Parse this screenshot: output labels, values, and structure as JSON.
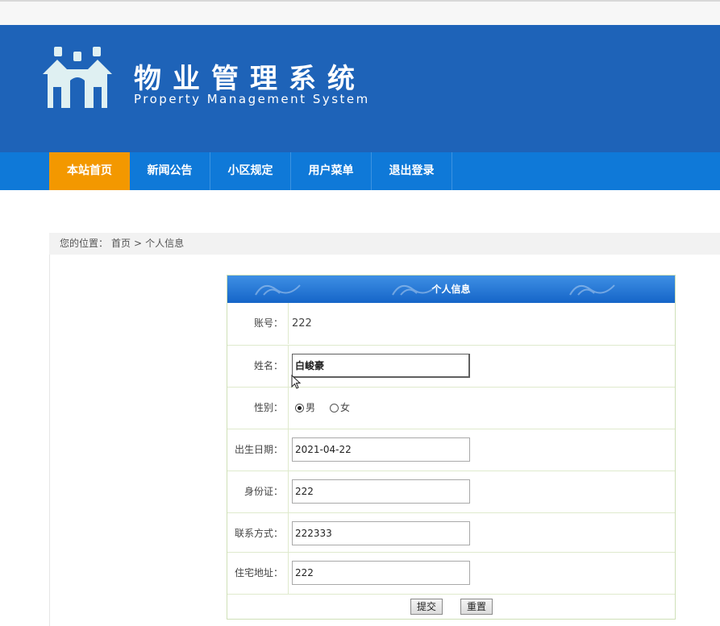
{
  "brand": {
    "title_cn": "物业管理系统",
    "title_en": "Property Management System"
  },
  "nav": [
    {
      "label": "本站首页",
      "active": true
    },
    {
      "label": "新闻公告",
      "active": false
    },
    {
      "label": "小区规定",
      "active": false
    },
    {
      "label": "用户菜单",
      "active": false
    },
    {
      "label": "退出登录",
      "active": false
    }
  ],
  "breadcrumb": {
    "prefix": "您的位置：",
    "home": "首页",
    "sep": ">",
    "current": "个人信息"
  },
  "form": {
    "title": "个人信息",
    "account_label": "账号：",
    "account_value": "222",
    "name_label": "姓名：",
    "name_value": "白峻豪",
    "gender_label": "性别：",
    "gender_options": [
      "男",
      "女"
    ],
    "gender_selected": "男",
    "birth_label": "出生日期：",
    "birth_value": "2021-04-22",
    "idcard_label": "身份证：",
    "idcard_value": "222",
    "phone_label": "联系方式：",
    "phone_value": "222333",
    "address_label": "住宅地址：",
    "address_value": "222",
    "submit_label": "提交",
    "reset_label": "重置"
  },
  "colors": {
    "banner": "#1e63b8",
    "nav": "#0f79d8",
    "nav_active": "#f39800"
  }
}
